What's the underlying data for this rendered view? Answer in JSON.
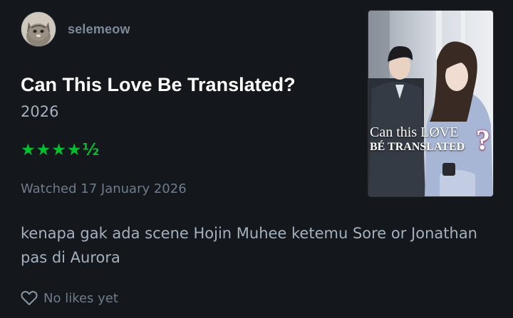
{
  "user": {
    "name": "selemeow"
  },
  "film": {
    "title": "Can This Love Be Translated?",
    "year": "2026"
  },
  "rating": {
    "stars": "★★★★½",
    "value": 4.5,
    "max": 5
  },
  "watched": "Watched 17 January 2026",
  "review": "kenapa gak ada scene Hojin Muhee ketemu Sore or Jonathan pas di Aurora",
  "likes": {
    "label": "No likes yet",
    "icon": "heart-outline-icon"
  },
  "poster": {
    "line1": "Can this LØVE",
    "line2": "BÉ TRANSLATED",
    "mark": "?"
  },
  "colors": {
    "background": "#14181c",
    "star": "#00c030",
    "username": "#7d8a99",
    "muted": "#6f7c8b"
  }
}
